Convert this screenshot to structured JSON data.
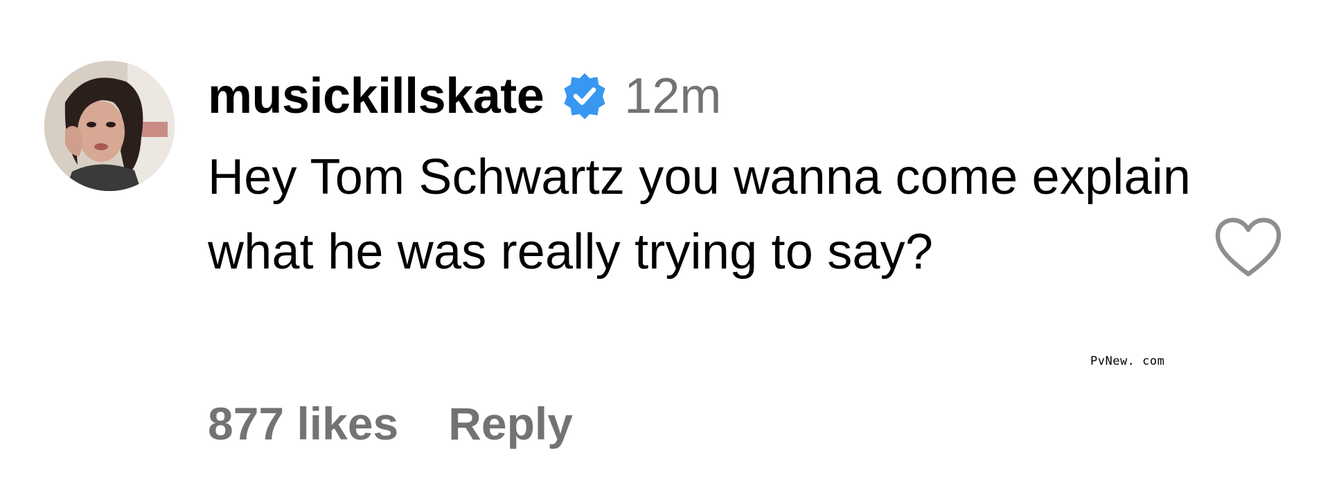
{
  "comment": {
    "username": "musickillskate",
    "verified": true,
    "timestamp": "12m",
    "text": "Hey Tom Schwartz you wanna come explain what he was really trying to say?",
    "likes": "877 likes",
    "reply_label": "Reply",
    "liked": false
  },
  "icons": {
    "verified": "verified-badge-icon",
    "like": "heart-outline-icon"
  },
  "colors": {
    "text_primary": "#000000",
    "text_secondary": "#737373",
    "verified_blue": "#3897F0",
    "heart_outline": "#8e8e8e"
  },
  "watermark": "PvNew. com"
}
